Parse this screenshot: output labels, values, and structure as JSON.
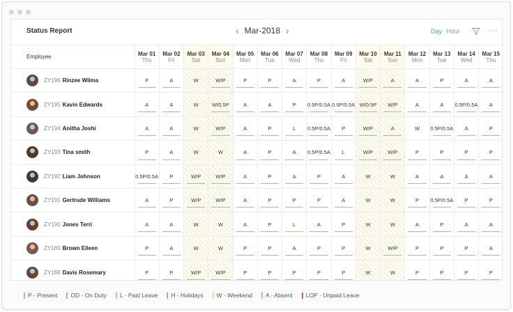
{
  "report": {
    "title": "Status Report",
    "month": "Mar-2018",
    "view_day": "Day",
    "view_hour": "Hour"
  },
  "columns": {
    "employee_header": "Employee",
    "days": [
      {
        "date": "Mar 01",
        "day": "Thu",
        "weekend": false
      },
      {
        "date": "Mar 02",
        "day": "Fri",
        "weekend": false
      },
      {
        "date": "Mar 03",
        "day": "Sat",
        "weekend": true
      },
      {
        "date": "Mar 04",
        "day": "Sun",
        "weekend": true
      },
      {
        "date": "Mar 05",
        "day": "Mon",
        "weekend": false
      },
      {
        "date": "Mar 06",
        "day": "Tue",
        "weekend": false
      },
      {
        "date": "Mar 07",
        "day": "Wed",
        "weekend": false
      },
      {
        "date": "Mar 08",
        "day": "Thu",
        "weekend": false
      },
      {
        "date": "Mar 09",
        "day": "Fri",
        "weekend": false
      },
      {
        "date": "Mar 10",
        "day": "Sat",
        "weekend": true
      },
      {
        "date": "Mar 11",
        "day": "Sun",
        "weekend": true
      },
      {
        "date": "Mar 12",
        "day": "Mon",
        "weekend": false
      },
      {
        "date": "Mar 13",
        "day": "Tue",
        "weekend": false
      },
      {
        "date": "Mar 14",
        "day": "Wed",
        "weekend": false
      },
      {
        "date": "Mar 15",
        "day": "Thu",
        "weekend": false
      }
    ]
  },
  "employees": [
    {
      "id": "ZY196",
      "name": "Rinzee Wilma",
      "avatar_color": "#5a4a42",
      "statuses": [
        "P",
        "A",
        "W",
        "W/P",
        "P",
        "P",
        "A",
        "P",
        "A",
        "W/P",
        "A",
        "A",
        "P",
        "A",
        "A"
      ]
    },
    {
      "id": "ZY195",
      "name": "Kavin Edwards",
      "avatar_color": "#7a4a2e",
      "statuses": [
        "A",
        "A",
        "W",
        "W/0.5P",
        "A",
        "A",
        "P",
        "0.5P/0.5A",
        "0.5P/0.5A",
        "W/0.5P",
        "W/P",
        "A",
        "A",
        "0.5P/0.5A",
        "A"
      ]
    },
    {
      "id": "ZY194",
      "name": "Anitha Joshi",
      "avatar_color": "#6a5a55",
      "statuses": [
        "A",
        "A",
        "W",
        "W/P",
        "A",
        "P",
        "L",
        "0.5P/0.5A",
        "P",
        "W/P",
        "A",
        "W",
        "0.5P/0.5A",
        "A",
        "P"
      ]
    },
    {
      "id": "ZY193",
      "name": "Tina smith",
      "avatar_color": "#4a3a30",
      "statuses": [
        "P",
        "A",
        "W",
        "W",
        "A",
        "P",
        "A",
        "0.5P/0.5A",
        "L",
        "W/P",
        "W/P",
        "P",
        "P",
        "P",
        "P"
      ]
    },
    {
      "id": "ZY192",
      "name": "Liam Johnson",
      "avatar_color": "#3a3a3a",
      "statuses": [
        "0.5P/0.5A",
        "P",
        "W/P",
        "W/P",
        "A",
        "P",
        "A",
        "P",
        "A",
        "W",
        "W",
        "A",
        "A",
        "A",
        "A"
      ]
    },
    {
      "id": "ZY191",
      "name": "Gertrude Williams",
      "avatar_color": "#6b5040",
      "statuses": [
        "A",
        "P",
        "W/P",
        "W/P",
        "A",
        "P",
        "P",
        "P",
        "A",
        "W",
        "W",
        "P",
        "0.5P/0.5A",
        "P",
        "P"
      ]
    },
    {
      "id": "ZY190",
      "name": "Jones Terri",
      "avatar_color": "#5a4438",
      "statuses": [
        "A",
        "A",
        "W",
        "W",
        "A",
        "P",
        "L",
        "A",
        "P",
        "W",
        "W",
        "A",
        "P",
        "A",
        "A"
      ]
    },
    {
      "id": "ZY189",
      "name": "Brown Eileen",
      "avatar_color": "#7a5a48",
      "statuses": [
        "P",
        "A",
        "W",
        "W",
        "P",
        "P",
        "A",
        "P",
        "P",
        "W",
        "W/P",
        "P",
        "P",
        "P",
        "A"
      ]
    },
    {
      "id": "ZY188",
      "name": "Davis Rosemary",
      "avatar_color": "#5a4a3e",
      "statuses": [
        "P",
        "P",
        "W/P",
        "W/P",
        "P",
        "P",
        "P",
        "P",
        "P",
        "W",
        "W",
        "P",
        "P",
        "P",
        "P"
      ]
    }
  ],
  "legend": [
    {
      "label": "P - Present",
      "color": "#8fcf8a"
    },
    {
      "label": "OD - On Duty",
      "color": "#a9a9d6"
    },
    {
      "label": "L - Paid Leave",
      "color": "#e8b67a"
    },
    {
      "label": "H - Holidays",
      "color": "#8cb8d8"
    },
    {
      "label": "W - Weekend",
      "color": "#ecd98a"
    },
    {
      "label": "A - Absent",
      "color": "#e9a38f"
    },
    {
      "label": "LOP - Unpaid Leave",
      "color": "#e06060"
    }
  ],
  "status_colors": {
    "P": "#8fcf8a",
    "A": "#e9a38f",
    "L": "#e8b67a",
    "W": "#ecd98a",
    "half": "#e9a38f"
  }
}
